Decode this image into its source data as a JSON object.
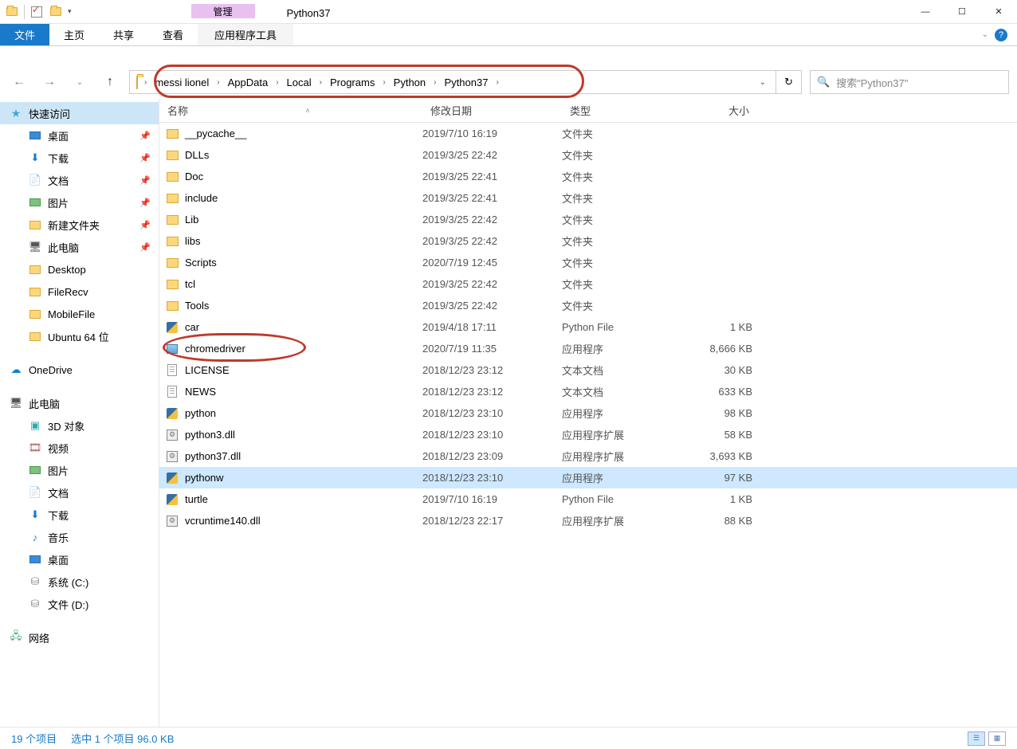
{
  "window": {
    "contextual_label": "管理",
    "title": "Python37",
    "tabs": {
      "file": "文件",
      "home": "主页",
      "share": "共享",
      "view": "查看",
      "apptools": "应用程序工具"
    }
  },
  "breadcrumb": [
    "messi lionel",
    "AppData",
    "Local",
    "Programs",
    "Python",
    "Python37"
  ],
  "search": {
    "placeholder": "搜索\"Python37\""
  },
  "columns": {
    "name": "名称",
    "date": "修改日期",
    "type": "类型",
    "size": "大小"
  },
  "sidebar": {
    "quick_access": "快速访问",
    "quick_items": [
      {
        "label": "桌面",
        "icon": "desktop",
        "pinned": true
      },
      {
        "label": "下载",
        "icon": "download",
        "pinned": true
      },
      {
        "label": "文档",
        "icon": "doc",
        "pinned": true
      },
      {
        "label": "图片",
        "icon": "pic",
        "pinned": true
      },
      {
        "label": "新建文件夹",
        "icon": "folder",
        "pinned": true
      },
      {
        "label": "此电脑",
        "icon": "pc",
        "pinned": true
      },
      {
        "label": "Desktop",
        "icon": "folder",
        "pinned": false
      },
      {
        "label": "FileRecv",
        "icon": "folder",
        "pinned": false
      },
      {
        "label": "MobileFile",
        "icon": "folder",
        "pinned": false
      },
      {
        "label": "Ubuntu 64 位",
        "icon": "folder",
        "pinned": false
      }
    ],
    "onedrive": "OneDrive",
    "this_pc": "此电脑",
    "pc_items": [
      {
        "label": "3D 对象",
        "icon": "3d"
      },
      {
        "label": "视频",
        "icon": "video"
      },
      {
        "label": "图片",
        "icon": "pic"
      },
      {
        "label": "文档",
        "icon": "doc"
      },
      {
        "label": "下载",
        "icon": "download"
      },
      {
        "label": "音乐",
        "icon": "music"
      },
      {
        "label": "桌面",
        "icon": "desktop"
      },
      {
        "label": "系统 (C:)",
        "icon": "disk"
      },
      {
        "label": "文件 (D:)",
        "icon": "disk"
      }
    ],
    "network": "网络"
  },
  "files": [
    {
      "name": "__pycache__",
      "date": "2019/7/10 16:19",
      "type": "文件夹",
      "size": "",
      "icon": "folder"
    },
    {
      "name": "DLLs",
      "date": "2019/3/25 22:42",
      "type": "文件夹",
      "size": "",
      "icon": "folder"
    },
    {
      "name": "Doc",
      "date": "2019/3/25 22:41",
      "type": "文件夹",
      "size": "",
      "icon": "folder"
    },
    {
      "name": "include",
      "date": "2019/3/25 22:41",
      "type": "文件夹",
      "size": "",
      "icon": "folder"
    },
    {
      "name": "Lib",
      "date": "2019/3/25 22:42",
      "type": "文件夹",
      "size": "",
      "icon": "folder"
    },
    {
      "name": "libs",
      "date": "2019/3/25 22:42",
      "type": "文件夹",
      "size": "",
      "icon": "folder"
    },
    {
      "name": "Scripts",
      "date": "2020/7/19 12:45",
      "type": "文件夹",
      "size": "",
      "icon": "folder"
    },
    {
      "name": "tcl",
      "date": "2019/3/25 22:42",
      "type": "文件夹",
      "size": "",
      "icon": "folder"
    },
    {
      "name": "Tools",
      "date": "2019/3/25 22:42",
      "type": "文件夹",
      "size": "",
      "icon": "folder"
    },
    {
      "name": "car",
      "date": "2019/4/18 17:11",
      "type": "Python File",
      "size": "1 KB",
      "icon": "py"
    },
    {
      "name": "chromedriver",
      "date": "2020/7/19 11:35",
      "type": "应用程序",
      "size": "8,666 KB",
      "icon": "exe"
    },
    {
      "name": "LICENSE",
      "date": "2018/12/23 23:12",
      "type": "文本文档",
      "size": "30 KB",
      "icon": "txt"
    },
    {
      "name": "NEWS",
      "date": "2018/12/23 23:12",
      "type": "文本文档",
      "size": "633 KB",
      "icon": "txt"
    },
    {
      "name": "python",
      "date": "2018/12/23 23:10",
      "type": "应用程序",
      "size": "98 KB",
      "icon": "pyexe"
    },
    {
      "name": "python3.dll",
      "date": "2018/12/23 23:10",
      "type": "应用程序扩展",
      "size": "58 KB",
      "icon": "dll"
    },
    {
      "name": "python37.dll",
      "date": "2018/12/23 23:09",
      "type": "应用程序扩展",
      "size": "3,693 KB",
      "icon": "dll"
    },
    {
      "name": "pythonw",
      "date": "2018/12/23 23:10",
      "type": "应用程序",
      "size": "97 KB",
      "icon": "pyexe",
      "selected": true
    },
    {
      "name": "turtle",
      "date": "2019/7/10 16:19",
      "type": "Python File",
      "size": "1 KB",
      "icon": "py"
    },
    {
      "name": "vcruntime140.dll",
      "date": "2018/12/23 22:17",
      "type": "应用程序扩展",
      "size": "88 KB",
      "icon": "dll"
    }
  ],
  "status": {
    "count": "19 个项目",
    "selected": "选中 1 个项目 96.0 KB"
  }
}
